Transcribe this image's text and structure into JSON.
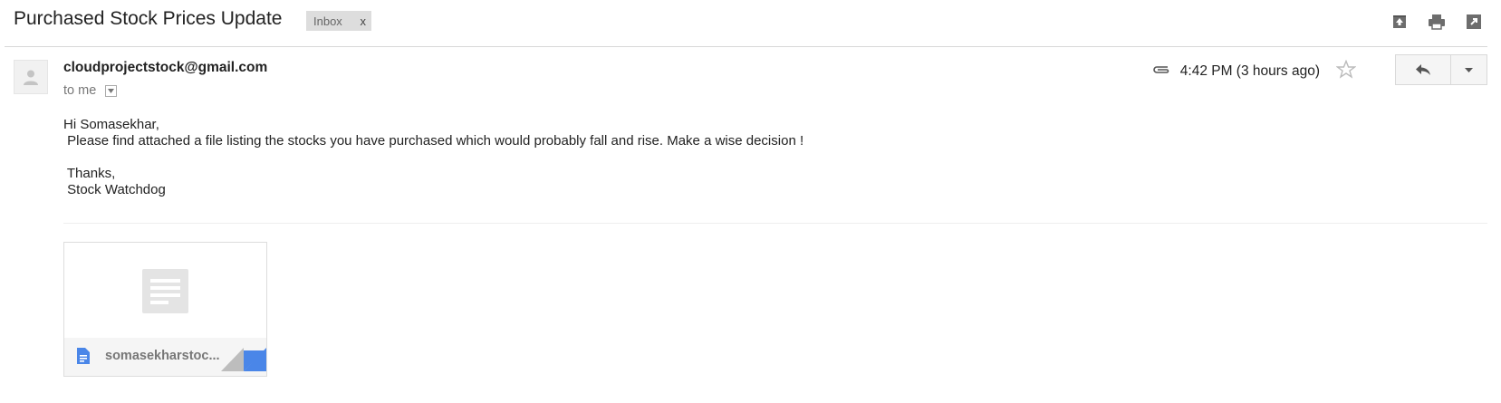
{
  "email": {
    "subject": "Purchased Stock Prices Update",
    "label": "Inbox",
    "label_remove": "x",
    "sender": "cloudprojectstock@gmail.com",
    "recipient": "to me",
    "time": "4:42 PM (3 hours ago)",
    "body": "Hi Somasekhar,\n Please find attached a file listing the stocks you have purchased which would probably fall and rise. Make a wise decision !\n\n Thanks,\n Stock Watchdog",
    "attachment": {
      "filename": "somasekharstoc..."
    }
  },
  "icons": {
    "archive": "archive-icon",
    "print": "print-icon",
    "open_new_window": "open-in-new-window-icon",
    "attachment": "paperclip-icon",
    "star": "star-icon",
    "reply": "reply-icon",
    "more": "chevron-down-icon",
    "avatar": "person-icon",
    "file": "document-icon"
  },
  "colors": {
    "accent": "#4a86e8",
    "label_bg": "#dddddd",
    "button_bg": "#f5f5f5"
  }
}
